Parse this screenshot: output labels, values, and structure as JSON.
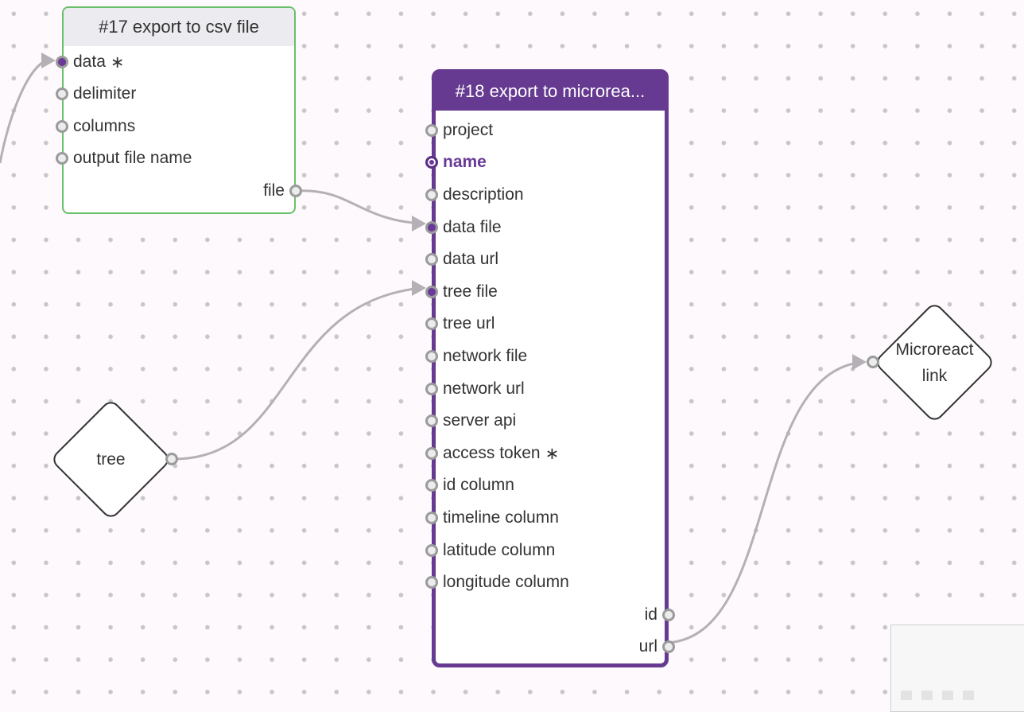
{
  "nodes": {
    "csv": {
      "title": "#17 export to csv file",
      "inputs": [
        {
          "label": "data",
          "required_mark": "∗",
          "connected": true
        },
        {
          "label": "delimiter",
          "required_mark": "",
          "connected": false
        },
        {
          "label": "columns",
          "required_mark": "",
          "connected": false
        },
        {
          "label": "output file name",
          "required_mark": "",
          "connected": false
        }
      ],
      "outputs": [
        {
          "label": "file"
        }
      ]
    },
    "microreact": {
      "title": "#18 export to microrea...",
      "inputs": [
        {
          "label": "project",
          "required_mark": "",
          "connected": false
        },
        {
          "label": "name",
          "required_mark": "",
          "connected": false,
          "active": true
        },
        {
          "label": "description",
          "required_mark": "",
          "connected": false
        },
        {
          "label": "data file",
          "required_mark": "",
          "connected": true
        },
        {
          "label": "data url",
          "required_mark": "",
          "connected": false
        },
        {
          "label": "tree file",
          "required_mark": "",
          "connected": true
        },
        {
          "label": "tree url",
          "required_mark": "",
          "connected": false
        },
        {
          "label": "network file",
          "required_mark": "",
          "connected": false
        },
        {
          "label": "network url",
          "required_mark": "",
          "connected": false
        },
        {
          "label": "server api",
          "required_mark": "",
          "connected": false
        },
        {
          "label": "access token",
          "required_mark": "∗",
          "connected": false
        },
        {
          "label": "id column",
          "required_mark": "",
          "connected": false
        },
        {
          "label": "timeline column",
          "required_mark": "",
          "connected": false
        },
        {
          "label": "latitude column",
          "required_mark": "",
          "connected": false
        },
        {
          "label": "longitude column",
          "required_mark": "",
          "connected": false
        }
      ],
      "outputs": [
        {
          "label": "id"
        },
        {
          "label": "url"
        }
      ]
    },
    "tree_input": {
      "label": "tree"
    },
    "microreact_link_output": {
      "label": "Microreact\nlink"
    }
  },
  "colors": {
    "accent": "#653a90",
    "csv_border": "#6bbf6a",
    "edge": "#b4b0b6"
  }
}
